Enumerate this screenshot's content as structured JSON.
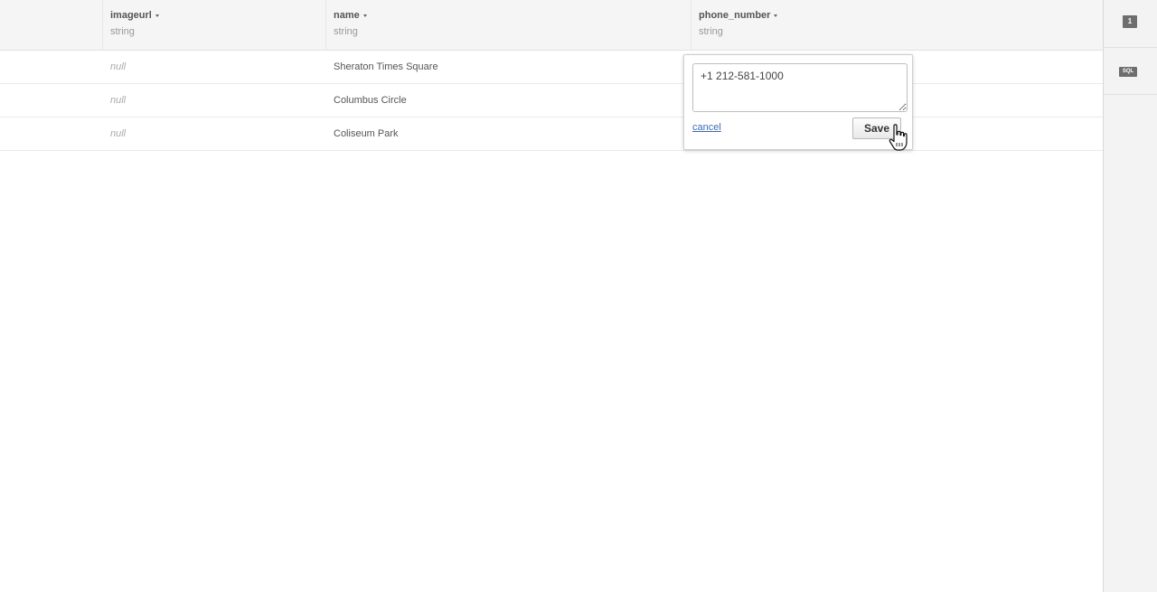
{
  "columns": [
    {
      "name": "imageurl",
      "type": "string"
    },
    {
      "name": "name",
      "type": "string"
    },
    {
      "name": "phone_number",
      "type": "string"
    }
  ],
  "rows": [
    {
      "imageurl": "null",
      "name": "Sheraton Times Square",
      "phone_number": ""
    },
    {
      "imageurl": "null",
      "name": "Columbus Circle",
      "phone_number": ""
    },
    {
      "imageurl": "null",
      "name": "Coliseum Park",
      "phone_number": ""
    }
  ],
  "editor": {
    "value": "+1 212-581-1000",
    "cancel_label": "cancel",
    "save_label": "Save"
  },
  "sidebar": {
    "badge_count": "1",
    "sql_label": "SQL"
  },
  "icons": {
    "sort": "caret-down-icon",
    "cursor": "hand-pointer-icon"
  }
}
